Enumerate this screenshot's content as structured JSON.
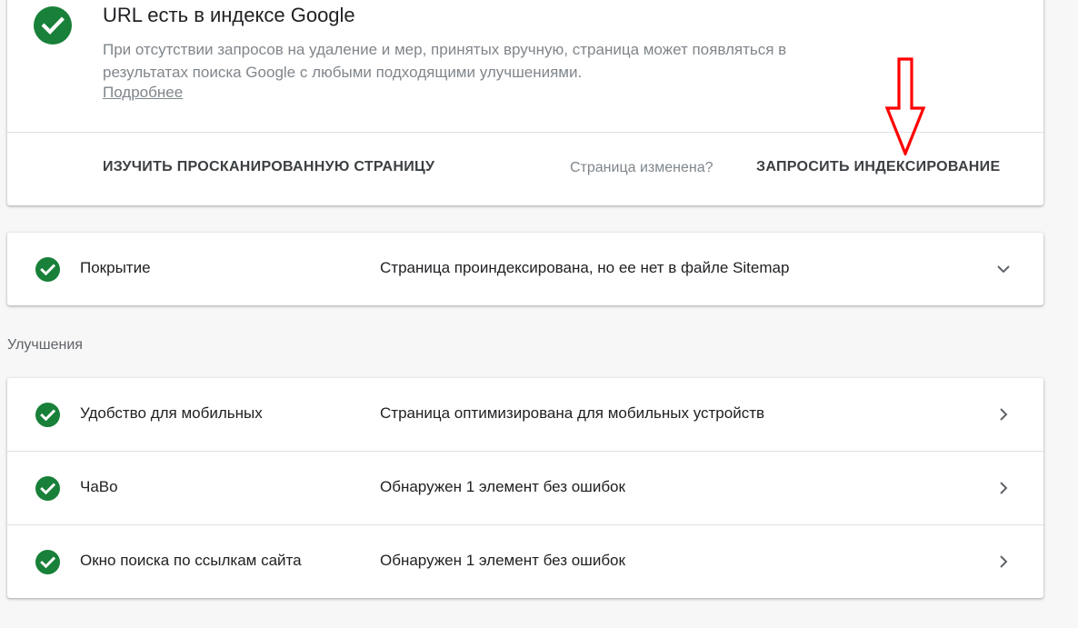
{
  "status": {
    "title": "URL есть в индексе Google",
    "description": "При отсутствии запросов на удаление и мер, принятых вручную, страница может появляться в результатах поиска Google с любыми подходящими улучшениями.",
    "more_link": "Подробнее",
    "actions": {
      "inspect_label": "ИЗУЧИТЬ ПРОСКАНИРОВАННУЮ СТРАНИЦУ",
      "changed_label": "Страница изменена?",
      "request_label": "ЗАПРОСИТЬ ИНДЕКСИРОВАНИЕ"
    },
    "icon": "check-circle-icon"
  },
  "coverage": {
    "name": "Покрытие",
    "value": "Страница проиндексирована, но ее нет в файле Sitemap",
    "icon": "check-circle-icon",
    "expand_icon": "chevron-down-icon"
  },
  "enhancements": {
    "heading": "Улучшения",
    "items": [
      {
        "name": "Удобство для мобильных",
        "value": "Страница оптимизирована для мобильных устройств"
      },
      {
        "name": "ЧаВо",
        "value": "Обнаружен 1 элемент без ошибок"
      },
      {
        "name": "Окно поиска по ссылкам сайта",
        "value": "Обнаружен 1 элемент без ошибок"
      }
    ]
  },
  "colors": {
    "success_green": "#188038",
    "annotation_red": "#ff0000",
    "muted_text": "#80868b",
    "background": "#f7f7f7"
  }
}
